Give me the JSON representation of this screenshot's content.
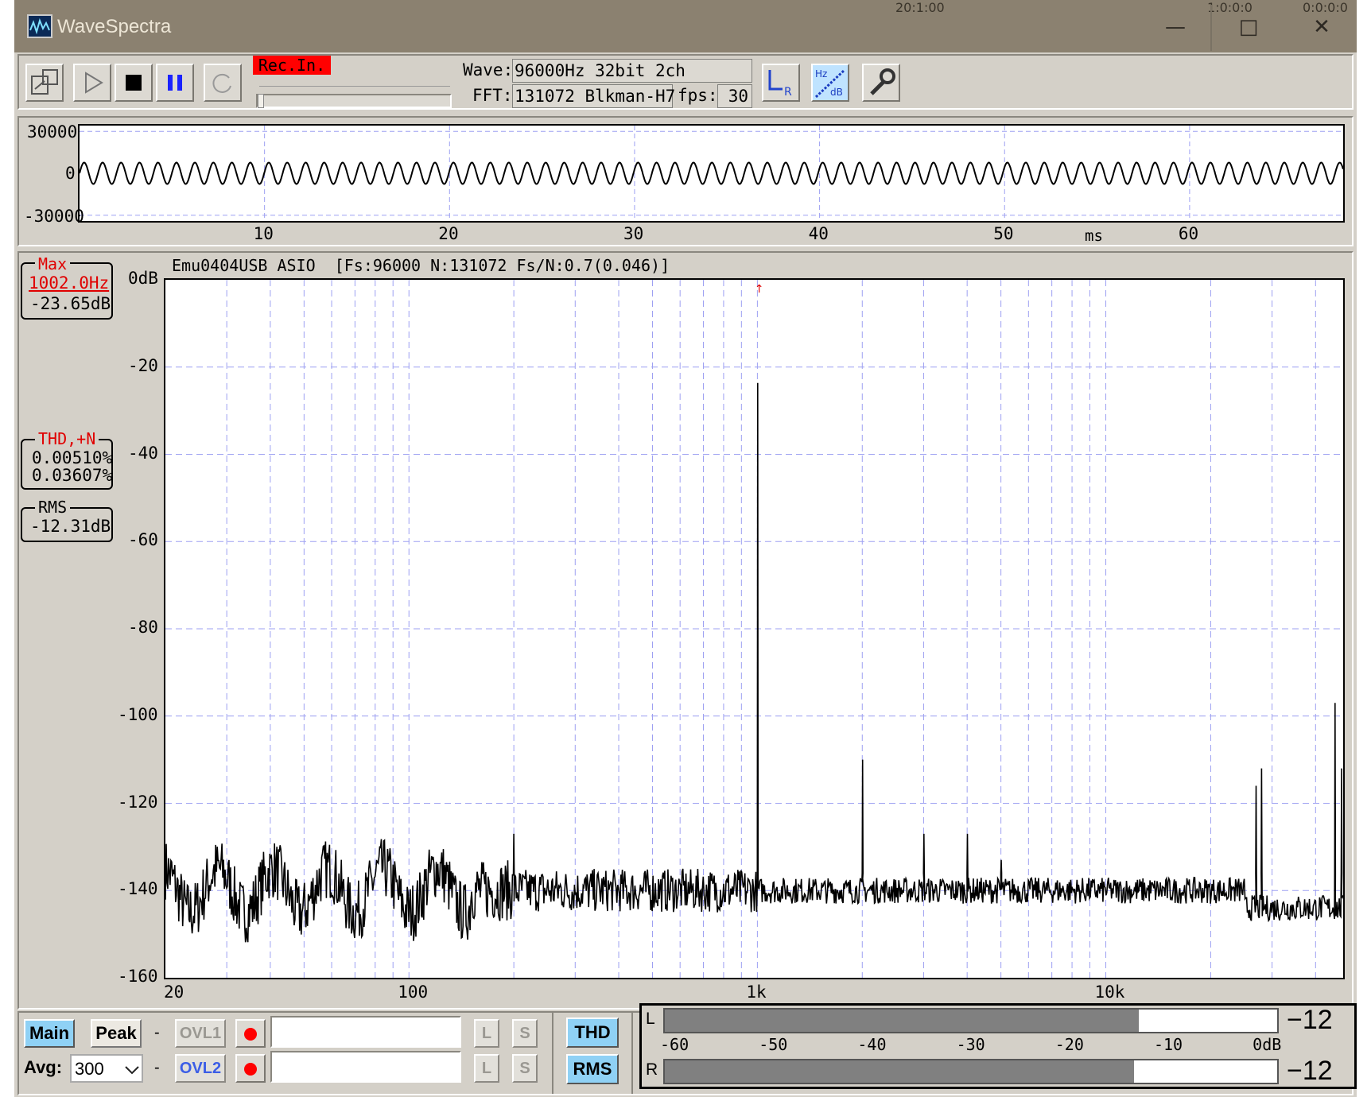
{
  "titlebar": {
    "title": "WaveSpectra",
    "bg_text_1": "20:1:00",
    "bg_text_2": "1:0:0:0",
    "bg_text_3": "0:0:0:0",
    "minimize_glyph": "—",
    "maximize_glyph": "□",
    "close_glyph": "✕"
  },
  "toolbar": {
    "rec_label": "Rec.In.",
    "wave_label": "Wave:",
    "wave_value": "96000Hz 32bit 2ch",
    "fft_label": "FFT:",
    "fft_value": "131072 Blkman-H7",
    "fps_label": "fps:",
    "fps_value": "30",
    "input_level": 0.0,
    "icons": [
      "open-file-icon",
      "play-icon",
      "stop-icon",
      "pause-icon",
      "loop-icon",
      "lr-channel-icon",
      "hz-db-scale-icon",
      "settings-wrench-icon"
    ]
  },
  "waveform": {
    "y_ticks": [
      "30000",
      "0",
      "-30000"
    ],
    "x_ticks": [
      "10",
      "20",
      "30",
      "40",
      "50",
      "60"
    ],
    "x_unit": "ms",
    "chart_data": {
      "type": "line",
      "x_range": [
        0,
        68.3
      ],
      "y_range": [
        -32768,
        32768
      ],
      "signal": "sine",
      "frequency_hz": 1002,
      "amplitude": 8500,
      "x_gridlines": [
        10,
        20,
        30,
        40,
        50,
        60
      ],
      "grid": true
    }
  },
  "readouts": {
    "max_title": "Max",
    "max_freq": "1002.0Hz",
    "max_level": "-23.65dB",
    "thd_title": "THD,+N",
    "thd_value": "0.00510%",
    "thdn_value": "0.03607%",
    "rms_title": "RMS",
    "rms_value": "-12.31dB"
  },
  "spectrum": {
    "header": "Emu0404USB ASIO  [Fs:96000 N:131072 Fs/N:0.7(0.046)]",
    "y_ticks": [
      "0dB",
      "-20",
      "-40",
      "-60",
      "-80",
      "-100",
      "-120",
      "-140",
      "-160"
    ],
    "x_ticks": [
      "20",
      "100",
      "1k",
      "10k"
    ],
    "marker": "↑",
    "chart_data": {
      "type": "line",
      "x_scale": "log",
      "xlim": [
        20,
        48000
      ],
      "ylim": [
        -160,
        0
      ],
      "noise_floor_db": -140,
      "peaks": [
        {
          "x": 1002,
          "y": -23.65
        },
        {
          "x": 2004,
          "y": -110
        },
        {
          "x": 200,
          "y": -127
        },
        {
          "x": 3006,
          "y": -127
        },
        {
          "x": 4008,
          "y": -127
        },
        {
          "x": 5010,
          "y": -133
        },
        {
          "x": 28000,
          "y": -112
        },
        {
          "x": 27000,
          "y": -116
        },
        {
          "x": 45500,
          "y": -97
        },
        {
          "x": 47500,
          "y": -112
        }
      ],
      "grid": true
    }
  },
  "bottom": {
    "main_label": "Main",
    "peak_label": "Peak",
    "avg_label": "Avg:",
    "avg_value": "300",
    "ovl1_label": "OVL1",
    "ovl2_label": "OVL2",
    "dash": "-",
    "l_label": "L",
    "s_label": "S",
    "thd_label": "THD",
    "rms_label": "RMS"
  },
  "meter": {
    "l_label": "L",
    "r_label": "R",
    "l_value": "−12",
    "r_value": "−12",
    "l_level_db": -12,
    "r_level_db": -12.5,
    "scale": [
      "-60",
      "-50",
      "-40",
      "-30",
      "-20",
      "-10",
      "0dB"
    ]
  },
  "colors": {
    "face": "#d4d0c8",
    "titlebar": "#8b8170",
    "grid": "#9da0f2",
    "readout_red": "#e00000",
    "button_blue": "#8fd1f5",
    "rec_red": "#ff0000"
  }
}
